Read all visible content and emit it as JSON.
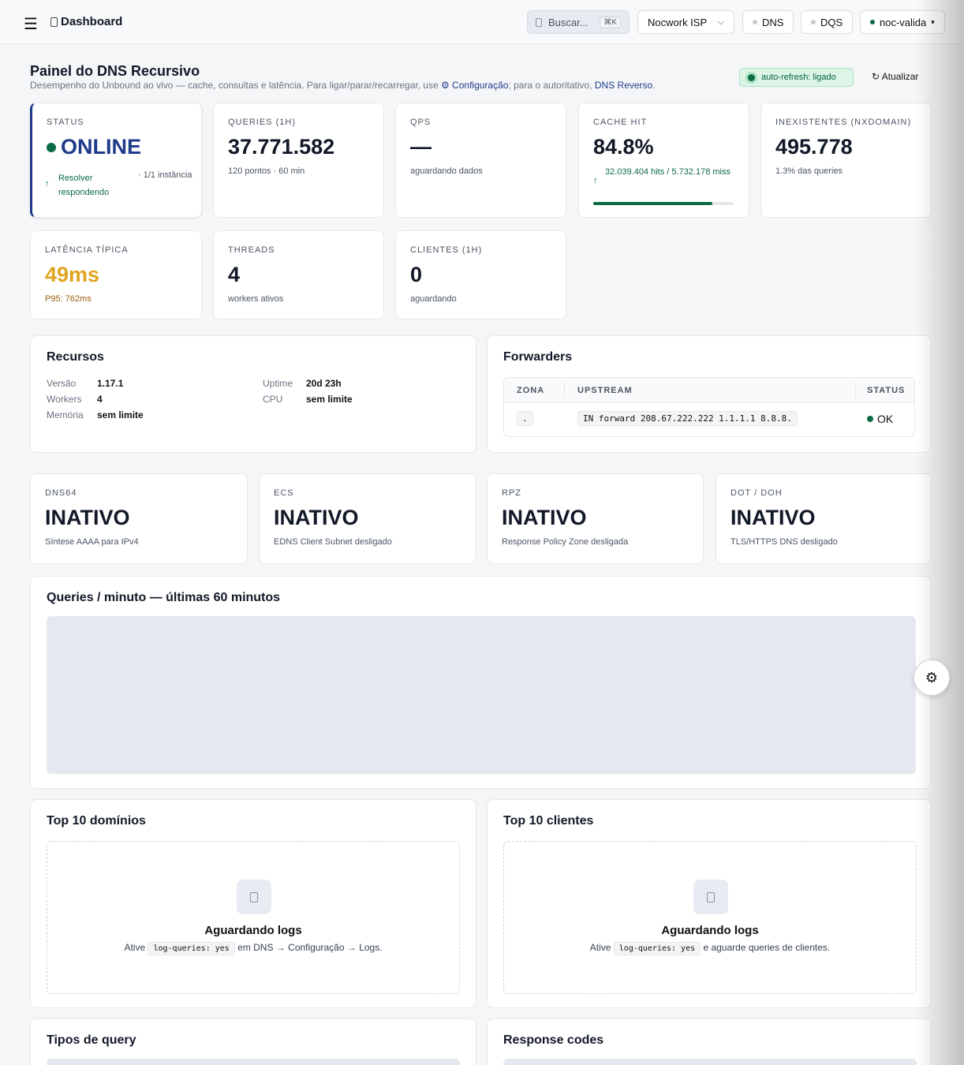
{
  "topbar": {
    "title": "Dashboard",
    "search_label": "Buscar...",
    "search_kbd": "⌘K",
    "org_label": "Nocwork ISP",
    "dns_label": "DNS",
    "dqs_label": "DQS",
    "host_label": "noc-valida"
  },
  "header": {
    "title": "Painel do DNS Recursivo",
    "subtitle_pre": "Desempenho do Unbound ao vivo — cache, consultas e latência. Para ligar/parar/recarregar, use ",
    "subtitle_link1": "⚙ Configuração",
    "subtitle_mid": "; para o autoritativo, ",
    "subtitle_link2": "DNS Reverso",
    "subtitle_end": ".",
    "autorefresh": "auto-refresh: ligado",
    "refresh": "↻ Atualizar"
  },
  "kpis": {
    "status": {
      "label": "STATUS",
      "value": "ONLINE",
      "sub1": "Resolver respondendo",
      "sub2": "· 1/1 instância"
    },
    "queries": {
      "label": "QUERIES (1H)",
      "value": "37.771.582",
      "sub": "120 pontos · 60 min"
    },
    "qps": {
      "label": "QPS",
      "value": "—",
      "sub": "aguardando dados"
    },
    "cache": {
      "label": "CACHE HIT",
      "value": "84.8%",
      "sub": "32.039.404 hits / 5.732.178 miss",
      "fill": 0.848
    },
    "nx": {
      "label": "INEXISTENTES (NXDOMAIN)",
      "value": "495.778",
      "sub": "1.3% das queries"
    },
    "latency": {
      "label": "LATÊNCIA TÍPICA",
      "value": "49ms",
      "sub": "P95: 762ms"
    },
    "threads": {
      "label": "THREADS",
      "value": "4",
      "sub": "workers ativos"
    },
    "clients": {
      "label": "CLIENTES (1H)",
      "value": "0",
      "sub": "aguardando"
    }
  },
  "resources": {
    "title": "Recursos",
    "versao_k": "Versão",
    "versao_v": "1.17.1",
    "workers_k": "Workers",
    "workers_v": "4",
    "memoria_k": "Memória",
    "memoria_v": "sem limite",
    "uptime_k": "Uptime",
    "uptime_v": "20d 23h",
    "cpu_k": "CPU",
    "cpu_v": "sem limite"
  },
  "forwarders": {
    "title": "Forwarders",
    "col_zona": "ZONA",
    "col_upstream": "UPSTREAM",
    "col_status": "STATUS",
    "row": {
      "zona": ".",
      "upstream": "IN forward 208.67.222.222 1.1.1.1 8.8.8.",
      "status": "OK"
    }
  },
  "features": {
    "dns64": {
      "label": "DNS64",
      "value": "INATIVO",
      "sub": "Síntese AAAA para IPv4"
    },
    "ecs": {
      "label": "ECS",
      "value": "INATIVO",
      "sub": "EDNS Client Subnet desligado"
    },
    "rpz": {
      "label": "RPZ",
      "value": "INATIVO",
      "sub": "Response Policy Zone desligada"
    },
    "dot": {
      "label": "DOT / DOH",
      "value": "INATIVO",
      "sub": "TLS/HTTPS DNS desligado"
    }
  },
  "queries_chart": {
    "title": "Queries / minuto — últimas 60 minutos"
  },
  "top_domains": {
    "title": "Top 10 domínios",
    "empty_title": "Aguardando logs",
    "text_pre": "Ative",
    "code": "log-queries: yes",
    "text_post": "em DNS → Configuração → Logs."
  },
  "top_clients": {
    "title": "Top 10 clientes",
    "empty_title": "Aguardando logs",
    "text_pre": "Ative",
    "code": "log-queries: yes",
    "text_post": "e aguarde queries de clientes."
  },
  "query_types": {
    "title": "Tipos de query"
  },
  "response_codes": {
    "title": "Response codes"
  },
  "colors": {
    "accent": "#1e3a8a",
    "success": "#0d6b43",
    "warning": "#d9a21a"
  },
  "icons": {
    "menu": "hamburger-icon",
    "gear": "gear-icon",
    "refresh": "refresh-icon"
  }
}
